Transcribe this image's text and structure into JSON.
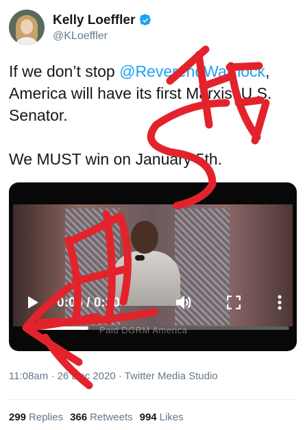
{
  "author": {
    "display_name": "Kelly Loeffler",
    "handle": "@KLoeffler",
    "verified_icon": "verified-badge-icon",
    "accent_color": "#1da1f2"
  },
  "tweet": {
    "line1_prefix": "If we don’t stop ",
    "mention": "@ReverendWarnock",
    "line1_suffix": ",",
    "line2": "America will have its first Marxist U.S.",
    "line3": "Senator.",
    "line4": "We MUST win on January 5th."
  },
  "video": {
    "time_display": "0:06 / 0:30",
    "caption": "Paid DGRM America",
    "progress_fraction": 0.24,
    "icons": [
      "play-icon",
      "volume-icon",
      "fullscreen-icon",
      "more-options-icon"
    ]
  },
  "meta": {
    "text": "11:08am · 26 Dec 2020 · Twitter Media Studio"
  },
  "stats": {
    "replies_count": "299",
    "replies_label": "Replies",
    "retweets_count": "366",
    "retweets_label": "Retweets",
    "likes_count": "994",
    "likes_label": "Likes"
  },
  "overlay": {
    "scribble_color": "#e3232b"
  }
}
